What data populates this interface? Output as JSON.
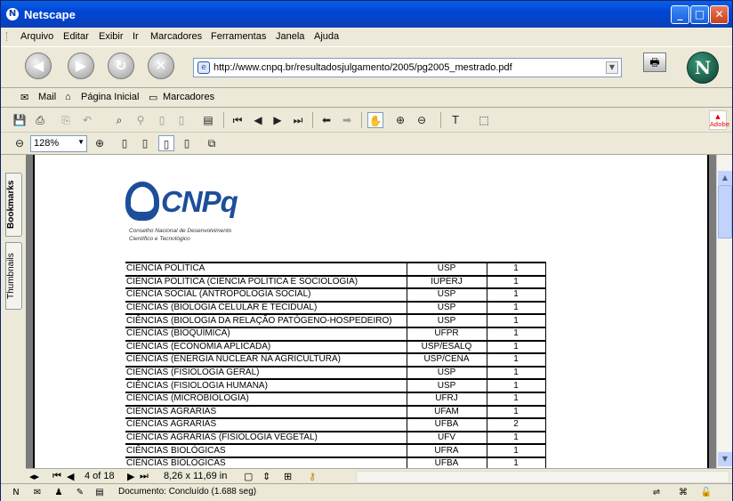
{
  "window": {
    "title": "Netscape"
  },
  "menu": [
    "Arquivo",
    "Editar",
    "Exibir",
    "Ir",
    "Marcadores",
    "Ferramentas",
    "Janela",
    "Ajuda"
  ],
  "nav": {
    "url": "http://www.cnpq.br/resultadosjulgamento/2005/pg2005_mestrado.pdf"
  },
  "personal": {
    "mail": "Mail",
    "home": "Página Inicial",
    "bookmarks": "Marcadores"
  },
  "pdf": {
    "zoom": "128%",
    "side_tabs": {
      "bookmarks": "Bookmarks",
      "thumbnails": "Thumbnails"
    },
    "page_indicator": "4 of 18",
    "page_size": "8,26 x 11,69 in"
  },
  "document": {
    "logo": {
      "name": "CNPq",
      "subtitle_line1": "Conselho Nacional de Desenvolvimento",
      "subtitle_line2": "Científico e Tecnológico"
    },
    "rows": [
      {
        "area": "CIÊNCIA POLÍTICA",
        "inst": "USP",
        "count": "1"
      },
      {
        "area": "CIÊNCIA POLÍTICA (CIÊNCIA POLÍTICA E SOCIOLOGIA)",
        "inst": "IUPERJ",
        "count": "1"
      },
      {
        "area": "CIÊNCIA SOCIAL (ANTROPOLOGIA SOCIAL)",
        "inst": "USP",
        "count": "1"
      },
      {
        "area": "CIÊNCIAS (BIOLOGIA CELULAR E TECIDUAL)",
        "inst": "USP",
        "count": "1"
      },
      {
        "area": "CIÊNCIAS (BIOLOGIA DA RELAÇÃO PATÓGENO-HOSPEDEIRO)",
        "inst": "USP",
        "count": "1"
      },
      {
        "area": "CIÊNCIAS (BIOQUÍMICA)",
        "inst": "UFPR",
        "count": "1"
      },
      {
        "area": "CIÊNCIAS (ECONOMIA APLICADA)",
        "inst": "USP/ESALQ",
        "count": "1"
      },
      {
        "area": "CIÊNCIAS (ENERGIA NUCLEAR NA AGRICULTURA)",
        "inst": "USP/CENA",
        "count": "1"
      },
      {
        "area": "CIÊNCIAS (FISIOLOGIA GERAL)",
        "inst": "USP",
        "count": "1"
      },
      {
        "area": "CIÊNCIAS (FISIOLOGIA HUMANA)",
        "inst": "USP",
        "count": "1"
      },
      {
        "area": "CIÊNCIAS (MICROBIOLOGIA)",
        "inst": "UFRJ",
        "count": "1"
      },
      {
        "area": "CIÊNCIAS AGRÁRIAS",
        "inst": "UFAM",
        "count": "1"
      },
      {
        "area": "CIÊNCIAS AGRÁRIAS",
        "inst": "UFBA",
        "count": "2"
      },
      {
        "area": "CIÊNCIAS AGRÁRIAS (FISIOLOGIA VEGETAL)",
        "inst": "UFV",
        "count": "1"
      },
      {
        "area": "CIÊNCIAS BIOLÓGICAS",
        "inst": "UFRA",
        "count": "1"
      },
      {
        "area": "CIÊNCIAS BIOLÓGICAS",
        "inst": "UFBA",
        "count": "1"
      }
    ]
  },
  "status": {
    "text": "Documento: Concluído (1.688 seg)"
  }
}
